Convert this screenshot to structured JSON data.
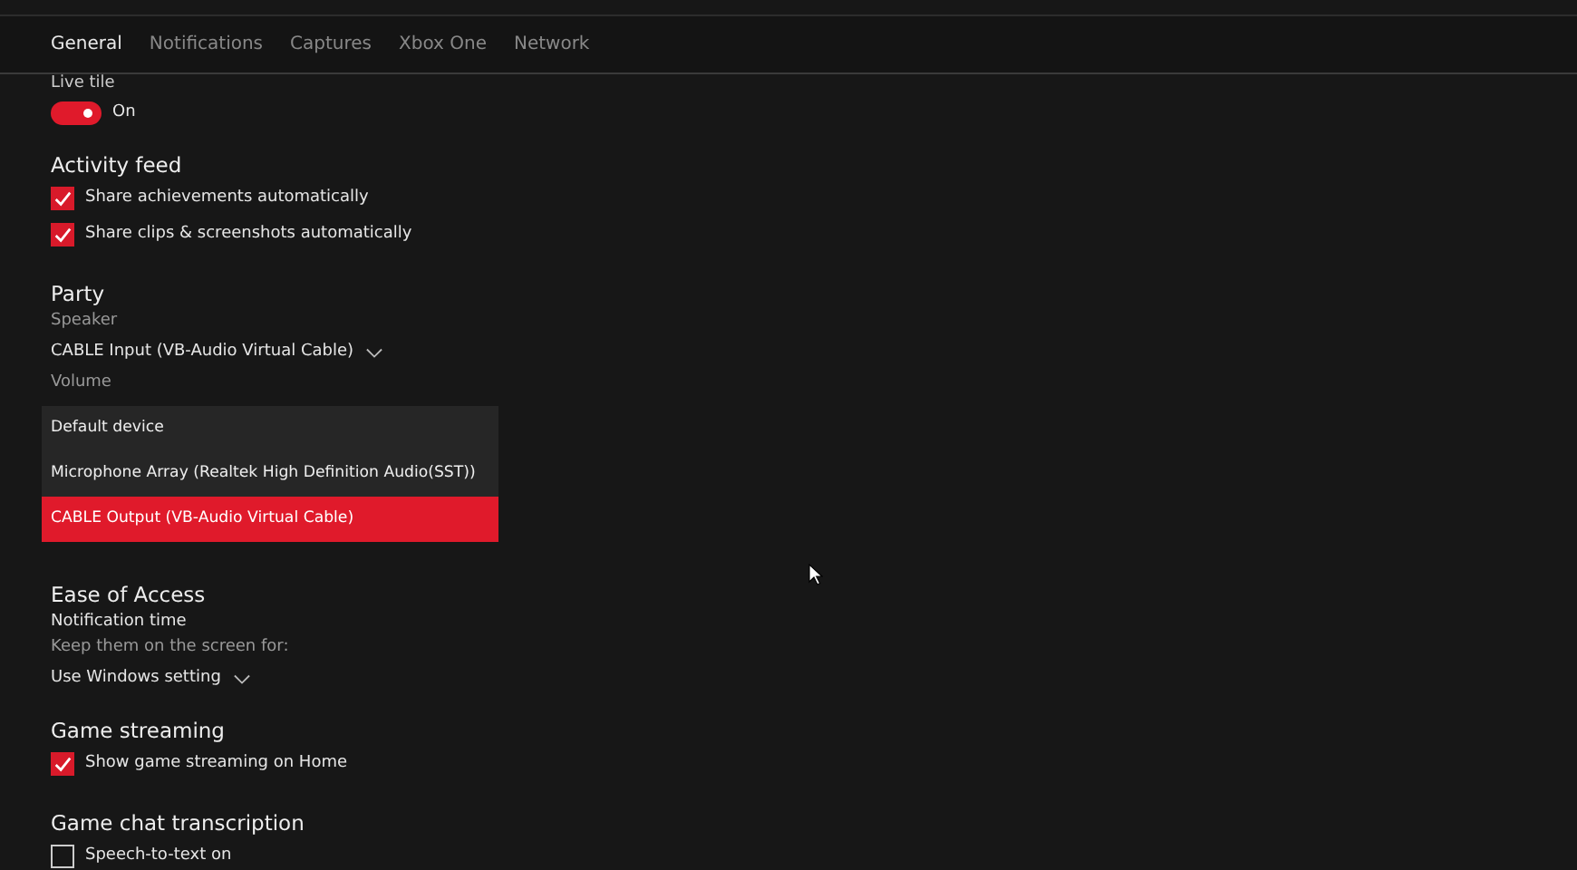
{
  "tabs": [
    {
      "label": "General",
      "selected": true
    },
    {
      "label": "Notifications",
      "selected": false
    },
    {
      "label": "Captures",
      "selected": false
    },
    {
      "label": "Xbox One",
      "selected": false
    },
    {
      "label": "Network",
      "selected": false
    }
  ],
  "live_tile": {
    "heading": "Live tile",
    "toggle": {
      "on": true,
      "label": "On"
    }
  },
  "activity_feed": {
    "heading": "Activity feed",
    "options": [
      {
        "label": "Share achievements automatically",
        "checked": true
      },
      {
        "label": "Share clips & screenshots automatically",
        "checked": true
      }
    ]
  },
  "party": {
    "heading": "Party",
    "speaker_label": "Speaker",
    "speaker_value": "CABLE Input (VB-Audio Virtual Cable)",
    "volume_label": "Volume",
    "dropdown_options": [
      {
        "label": "Default device",
        "selected": false
      },
      {
        "label": "Microphone Array (Realtek High Definition Audio(SST))",
        "selected": false
      },
      {
        "label": "CABLE Output (VB-Audio Virtual Cable)",
        "selected": true
      }
    ]
  },
  "ease_of_access": {
    "heading": "Ease of Access",
    "subheading": "Notification time",
    "hint": "Keep them on the screen for:",
    "value": "Use Windows setting"
  },
  "game_streaming": {
    "heading": "Game streaming",
    "options": [
      {
        "label": "Show game streaming on Home",
        "checked": true
      }
    ]
  },
  "game_chat_transcription": {
    "heading": "Game chat transcription",
    "options": [
      {
        "label": "Speech-to-text on",
        "checked": false
      }
    ]
  }
}
